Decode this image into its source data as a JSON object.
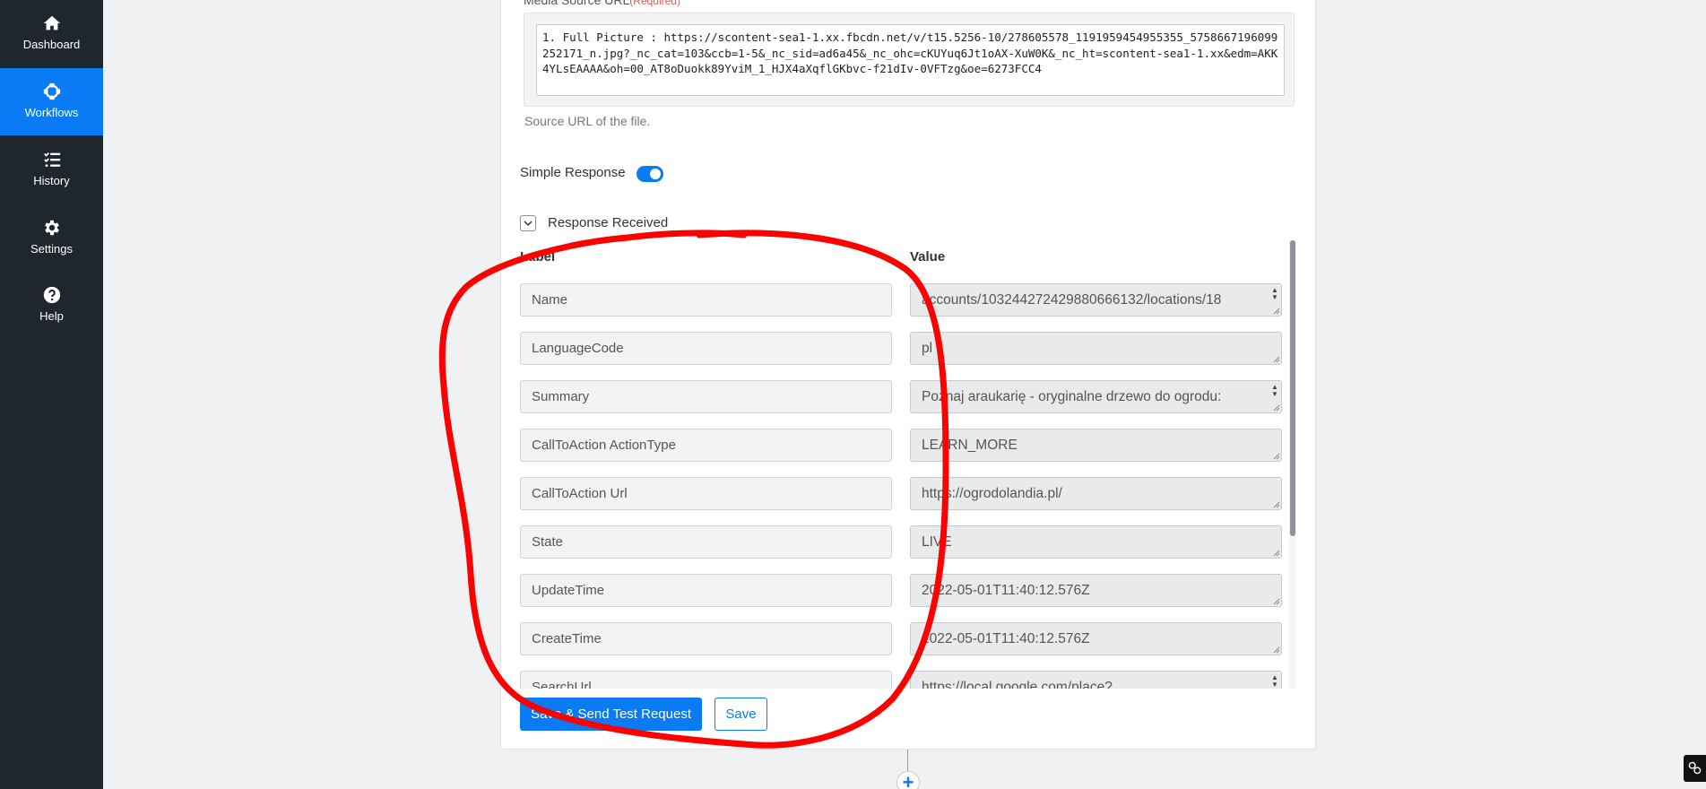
{
  "sidebar": {
    "items": [
      {
        "label": "Dashboard",
        "icon": "home-icon",
        "active": false
      },
      {
        "label": "Workflows",
        "icon": "workflows-icon",
        "active": true
      },
      {
        "label": "History",
        "icon": "history-list-icon",
        "active": false
      },
      {
        "label": "Settings",
        "icon": "gear-icon",
        "active": false
      },
      {
        "label": "Help",
        "icon": "question-icon",
        "active": false
      }
    ]
  },
  "form": {
    "media_label": "Media Source URL",
    "required_text": "(Required)",
    "media_url_value": "1. Full Picture : https://scontent-sea1-1.xx.fbcdn.net/v/t15.5256-10/278605578_1191959454955355_5758667196099252171_n.jpg?_nc_cat=103&ccb=1-5&_nc_sid=ad6a45&_nc_ohc=cKUYuq6Jt1oAX-XuW0K&_nc_ht=scontent-sea1-1.xx&edm=AKK4YLsEAAAA&oh=00_AT8oDuokk89YviM_1_HJX4aXqflGKbvc-f21dIv-0VFTzg&oe=6273FCC4",
    "media_help": "Source URL of the file.",
    "simple_response_label": "Simple Response",
    "simple_response_on": true,
    "response_received_label": "Response Received",
    "response_received_checked": true,
    "col_label_header": "Label",
    "col_value_header": "Value",
    "rows": [
      {
        "label": "Name",
        "value": "accounts/103244272429880666132/locations/18",
        "spinner": true
      },
      {
        "label": "LanguageCode",
        "value": "pl",
        "spinner": false
      },
      {
        "label": "Summary",
        "value": "Poznaj araukarię - oryginalne drzewo do ogrodu:",
        "spinner": true
      },
      {
        "label": "CallToAction ActionType",
        "value": "LEARN_MORE",
        "spinner": false
      },
      {
        "label": "CallToAction Url",
        "value": "https://ogrodolandia.pl/",
        "spinner": false
      },
      {
        "label": "State",
        "value": "LIVE",
        "spinner": false
      },
      {
        "label": "UpdateTime",
        "value": "2022-05-01T11:40:12.576Z",
        "spinner": false
      },
      {
        "label": "CreateTime",
        "value": "2022-05-01T11:40:12.576Z",
        "spinner": false
      },
      {
        "label": "SearchUrl",
        "value": "https://local.google.com/place?",
        "spinner": true
      }
    ],
    "save_send_label": "Save & Send Test Request",
    "save_label": "Save"
  },
  "add_step_symbol": "+",
  "colors": {
    "accent": "#0a7bf5",
    "sidebar": "#20262e",
    "annotation": "#ff0000"
  }
}
